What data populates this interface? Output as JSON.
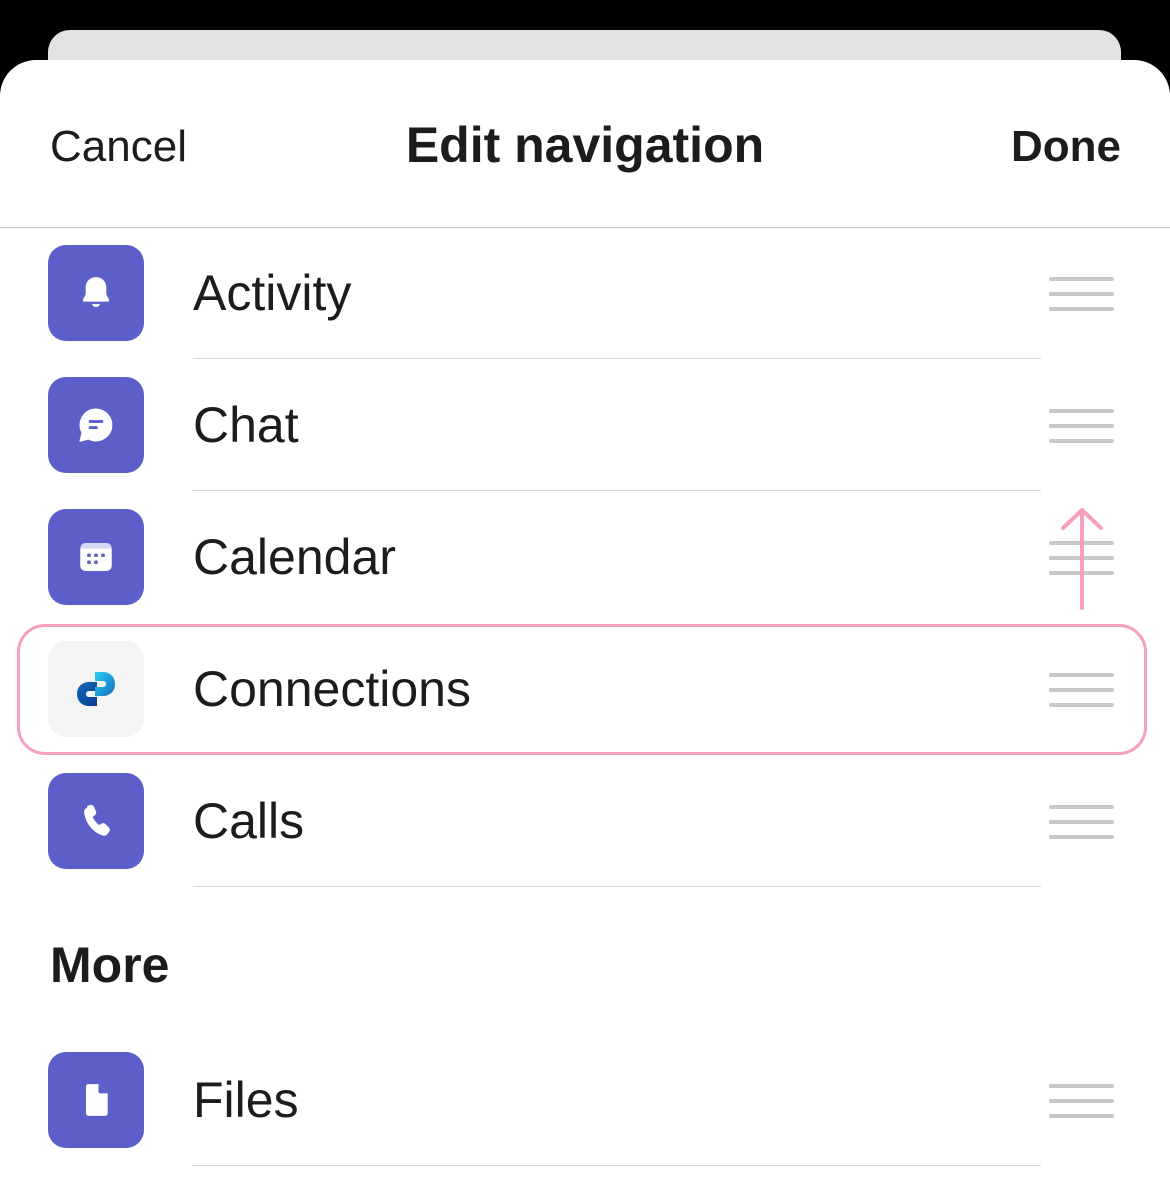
{
  "header": {
    "cancel_label": "Cancel",
    "title": "Edit navigation",
    "done_label": "Done"
  },
  "items": [
    {
      "label": "Activity",
      "icon": "bell-icon"
    },
    {
      "label": "Chat",
      "icon": "chat-bubble-icon"
    },
    {
      "label": "Calendar",
      "icon": "calendar-icon"
    },
    {
      "label": "Connections",
      "icon": "connections-icon",
      "highlighted": true
    },
    {
      "label": "Calls",
      "icon": "phone-icon"
    }
  ],
  "more_section": {
    "title": "More",
    "items": [
      {
        "label": "Files",
        "icon": "file-icon"
      }
    ]
  },
  "colors": {
    "app_icon_bg": "#5b5fc7",
    "highlight": "#f5a0bf",
    "drag_handle": "#c7c7cc"
  }
}
